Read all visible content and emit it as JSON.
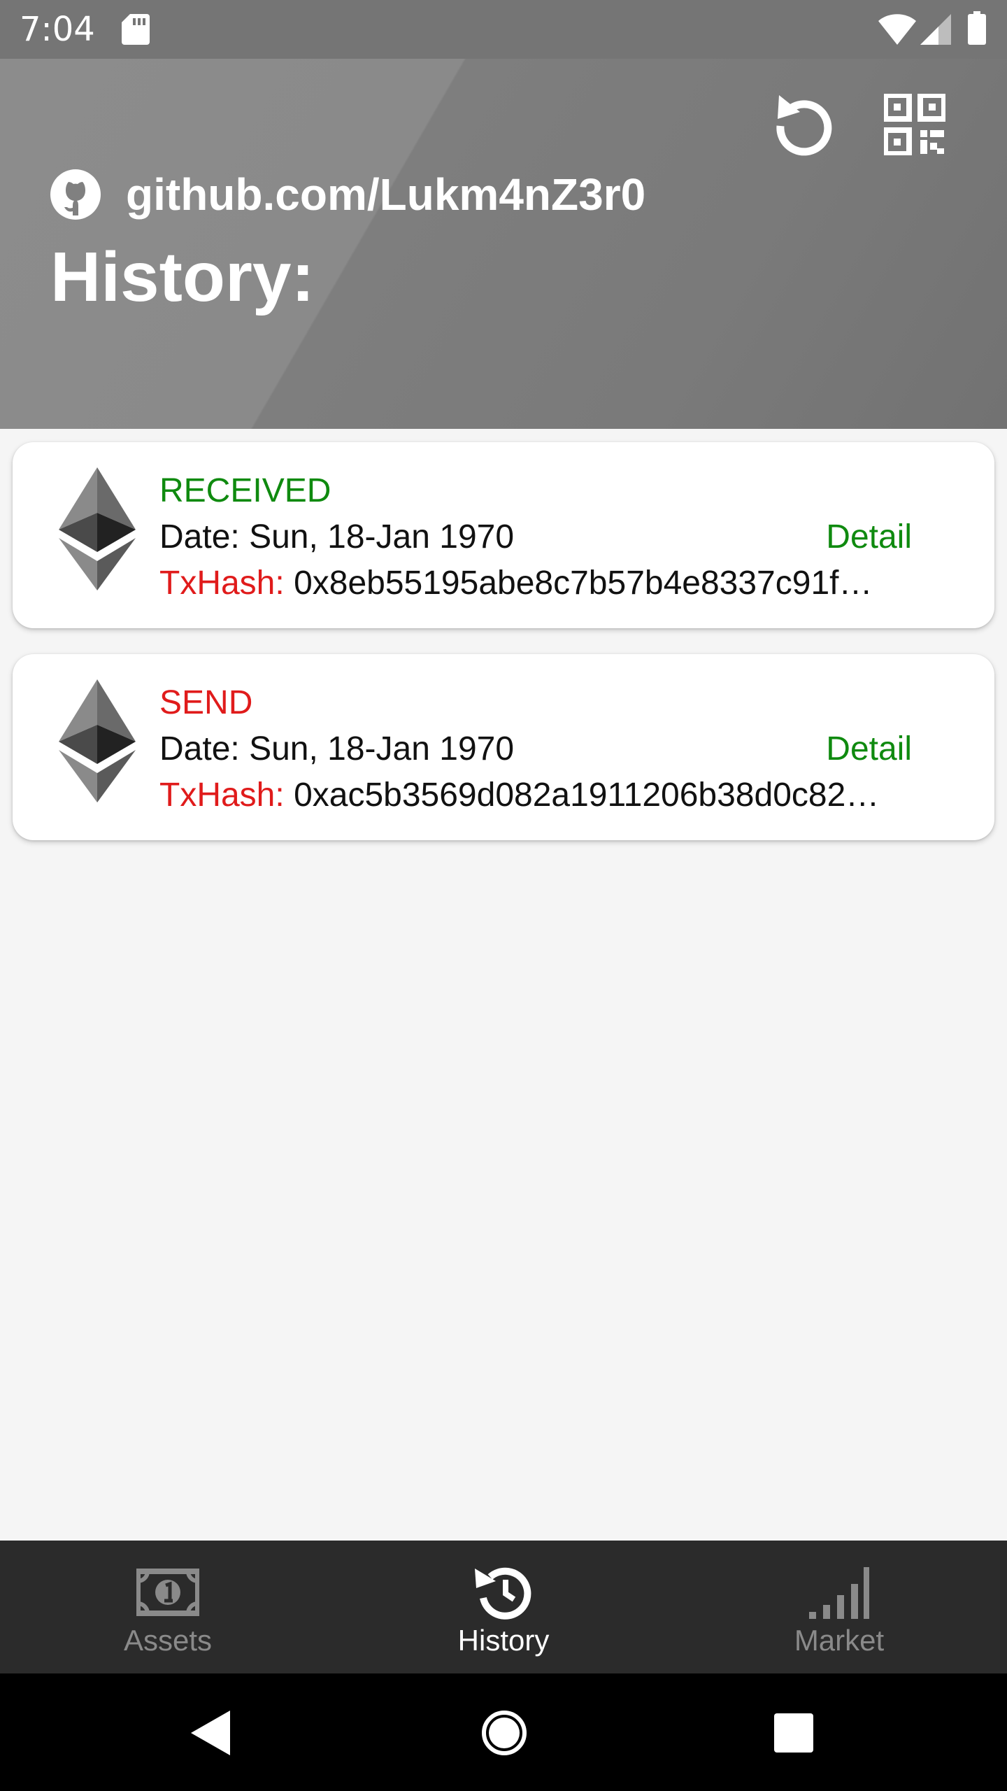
{
  "status_bar": {
    "time": "7:04"
  },
  "header": {
    "github_url": "github.com/Lukm4nZ3r0",
    "title": "History:"
  },
  "transactions": [
    {
      "type": "RECEIVED",
      "date": "Date: Sun, 18-Jan 1970",
      "detail_label": "Detail",
      "hash_label": "TxHash:",
      "hash": "0x8eb55195abe8c7b57b4e8337c91f…"
    },
    {
      "type": "SEND",
      "date": "Date: Sun, 18-Jan 1970",
      "detail_label": "Detail",
      "hash_label": "TxHash:",
      "hash": "0xac5b3569d082a1911206b38d0c82…"
    }
  ],
  "bottom_nav": {
    "items": [
      {
        "label": "Assets",
        "icon": "money-icon",
        "active": false
      },
      {
        "label": "History",
        "icon": "history-icon",
        "active": true
      },
      {
        "label": "Market",
        "icon": "signal-bars-icon",
        "active": false
      }
    ]
  },
  "colors": {
    "received": "#0f8a0f",
    "send": "#e01b1b",
    "nav_background": "#2b2b2b",
    "header_gray": "#808080"
  }
}
